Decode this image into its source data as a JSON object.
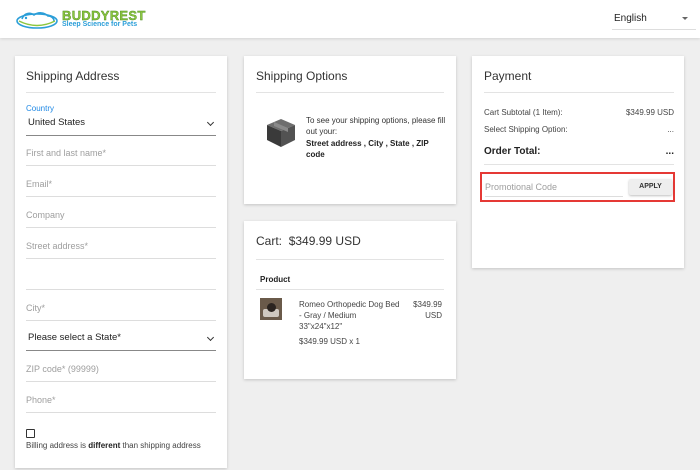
{
  "brand": {
    "name": "BUDDYREST",
    "tagline": "Sleep Science for Pets"
  },
  "language": {
    "selected": "English"
  },
  "shipping_address": {
    "title": "Shipping Address",
    "country_label": "Country",
    "country_value": "United States",
    "name_placeholder": "First and last name*",
    "email_placeholder": "Email*",
    "company_placeholder": "Company",
    "street_placeholder": "Street address*",
    "street2_placeholder": "",
    "city_placeholder": "City*",
    "state_value": "Please select a State*",
    "zip_placeholder": "ZIP code* (99999)",
    "phone_placeholder": "Phone*",
    "billing_text_1": "Billing address is ",
    "billing_text_bold": "different",
    "billing_text_2": " than shipping address"
  },
  "shipping_options": {
    "title": "Shipping Options",
    "message": "To see your shipping options, please fill out your:",
    "required_fields": "Street address , City , State , ZIP code"
  },
  "cart": {
    "title_label": "Cart:",
    "title_amount": "$349.99 USD",
    "column_header": "Product",
    "items": [
      {
        "name": "Romeo Orthopedic Dog Bed - Gray / Medium 33\"x24\"x12\"",
        "price": "$349.99 USD",
        "qty_line": "$349.99 USD x 1"
      }
    ]
  },
  "payment": {
    "title": "Payment",
    "subtotal_label": "Cart Subtotal (1 Item):",
    "subtotal_value": "$349.99 USD",
    "shipping_label": "Select Shipping Option:",
    "shipping_value": "...",
    "total_label": "Order Total:",
    "total_value": "...",
    "promo_placeholder": "Promotional Code",
    "apply_label": "APPLY"
  },
  "colors": {
    "accent": "#1e88e5",
    "highlight_border": "#e53935",
    "brand_green": "#8cc63f",
    "brand_blue": "#2b9ed8"
  }
}
